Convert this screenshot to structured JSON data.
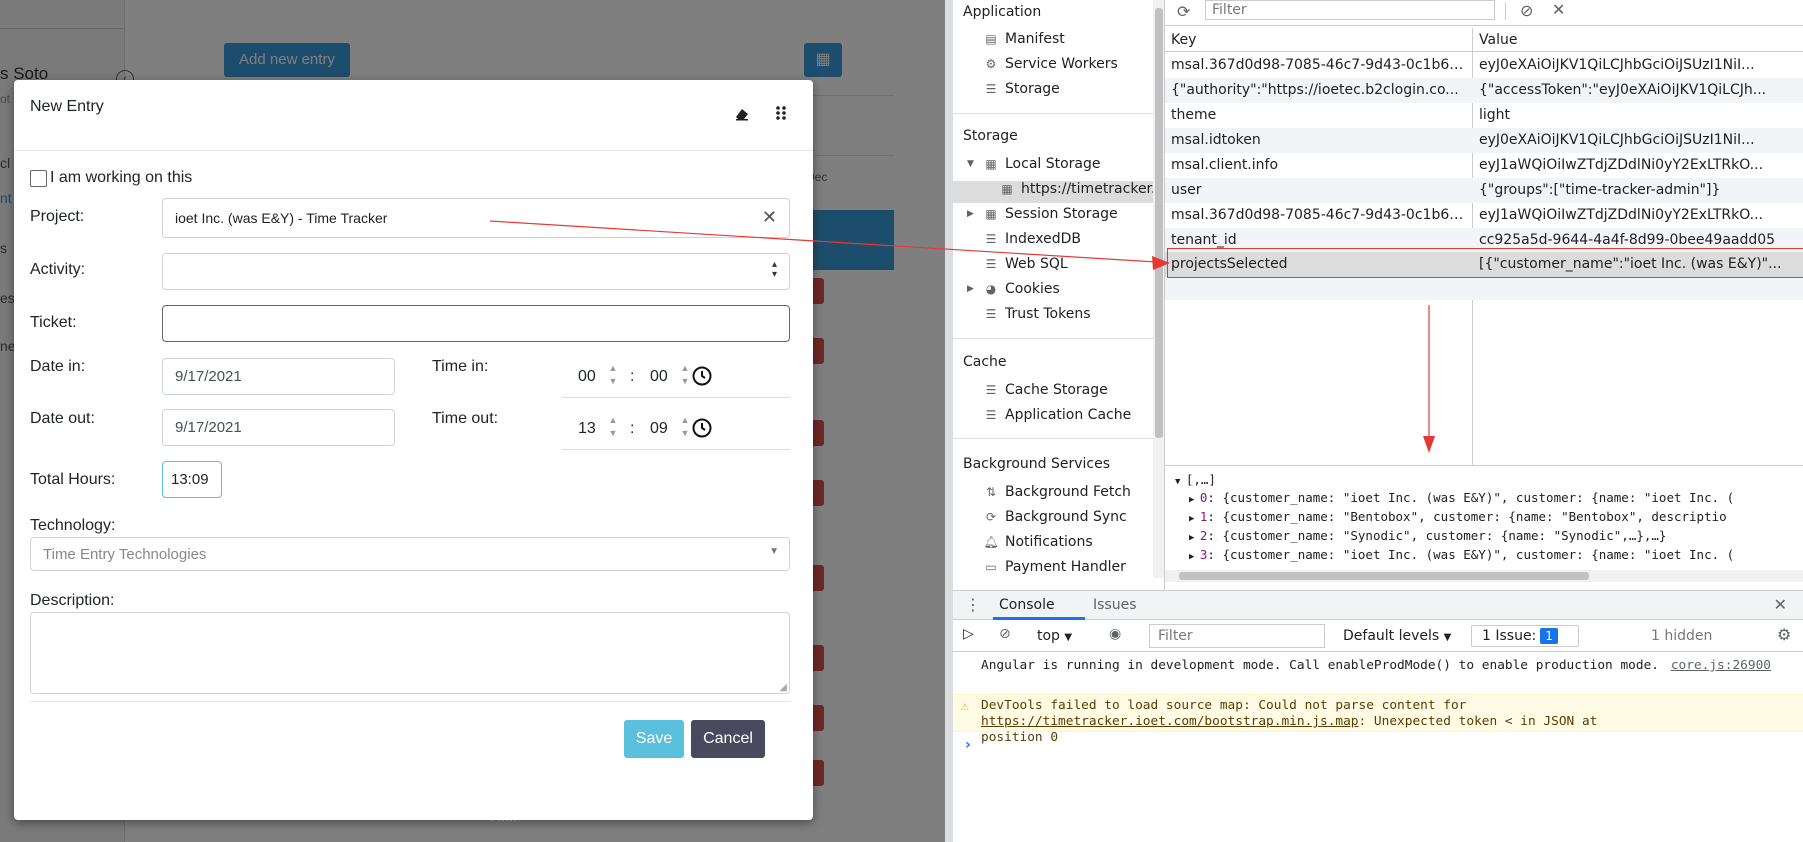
{
  "app": {
    "user_name": "s Soto",
    "user_sub": "ot",
    "nav_items": [
      "cl",
      "nt",
      "s",
      "es",
      "ne"
    ],
    "add_entry_label": "Add new entry",
    "dec_label": "Dec",
    "bottom_text": "P.M."
  },
  "modal": {
    "title": "New Entry",
    "working_label": "I am working on this",
    "project_label": "Project:",
    "project_value": "ioet Inc. (was E&Y) - Time Tracker",
    "activity_label": "Activity:",
    "ticket_label": "Ticket:",
    "date_in_label": "Date in:",
    "date_in_value": "9/17/2021",
    "time_in_label": "Time in:",
    "time_in_hour": "00",
    "time_in_min": "00",
    "date_out_label": "Date out:",
    "date_out_value": "9/17/2021",
    "time_out_label": "Time out:",
    "time_out_hour": "13",
    "time_out_min": "09",
    "colon": ":",
    "total_hours_label": "Total Hours:",
    "total_hours_value": "13:09",
    "technology_label": "Technology:",
    "technology_placeholder": "Time Entry Technologies",
    "description_label": "Description:",
    "save_label": "Save",
    "cancel_label": "Cancel"
  },
  "devtools": {
    "sidebar": {
      "application_header": "Application",
      "application_items": [
        "Manifest",
        "Service Workers",
        "Storage"
      ],
      "storage_header": "Storage",
      "local_storage": "Local Storage",
      "local_storage_origin": "https://timetracker.i",
      "storage_items": [
        "Session Storage",
        "IndexedDB",
        "Web SQL",
        "Cookies",
        "Trust Tokens"
      ],
      "cache_header": "Cache",
      "cache_items": [
        "Cache Storage",
        "Application Cache"
      ],
      "bg_header": "Background Services",
      "bg_items": [
        "Background Fetch",
        "Background Sync",
        "Notifications",
        "Payment Handler"
      ]
    },
    "filter_placeholder": "Filter",
    "table": {
      "key_header": "Key",
      "value_header": "Value",
      "rows": [
        {
          "key": "msal.367d0d98-7085-46c7-9d43-0c1b65...",
          "value": "eyJ0eXAiOiJKV1QiLCJhbGciOiJSUzI1NiI..."
        },
        {
          "key": "{\"authority\":\"https://ioetec.b2clogin.co...",
          "value": "{\"accessToken\":\"eyJ0eXAiOiJKV1QiLCJh..."
        },
        {
          "key": "theme",
          "value": "light"
        },
        {
          "key": "msal.idtoken",
          "value": "eyJ0eXAiOiJKV1QiLCJhbGciOiJSUzI1NiI..."
        },
        {
          "key": "msal.client.info",
          "value": "eyJ1aWQiOiIwZTdjZDdlNi0yY2ExLTRkO..."
        },
        {
          "key": "user",
          "value": "{\"groups\":[\"time-tracker-admin\"]}"
        },
        {
          "key": "msal.367d0d98-7085-46c7-9d43-0c1b65...",
          "value": "eyJ1aWQiOiIwZTdjZDdlNi0yY2ExLTRkO..."
        },
        {
          "key": "tenant_id",
          "value": "cc925a5d-9644-4a4f-8d99-0bee49aadd05"
        },
        {
          "key": "projectsSelected",
          "value": "[{\"customer_name\":\"ioet Inc. (was E&Y)\"..."
        }
      ]
    },
    "preview": {
      "root": "[,…]",
      "items": [
        {
          "idx": "0",
          "text": "{customer_name: \"ioet Inc. (was E&Y)\", customer: {name: \"ioet Inc. ("
        },
        {
          "idx": "1",
          "text": "{customer_name: \"Bentobox\", customer: {name: \"Bentobox\", descriptio"
        },
        {
          "idx": "2",
          "text": "{customer_name: \"Synodic\", customer: {name: \"Synodic\",…},…}"
        },
        {
          "idx": "3",
          "text": "{customer_name: \"ioet Inc. (was E&Y)\", customer: {name: \"ioet Inc. ("
        }
      ]
    },
    "console": {
      "tab_console": "Console",
      "tab_issues": "Issues",
      "context": "top",
      "filter_placeholder": "Filter",
      "levels": "Default levels",
      "issues_label": "1 Issue:",
      "issues_count": "1",
      "hidden": "1 hidden",
      "msg1": "Angular is running in development mode. Call enableProdMode() to enable production mode.",
      "msg1_src": "core.js:26900",
      "msg2_prefix": "DevTools failed to load source map: Could not parse content for ",
      "msg2_link": "https://timetracker.ioet.com/bootstrap.min.js.map",
      "msg2_suffix": ": Unexpected token < in JSON at position 0",
      "prompt": "›"
    }
  },
  "colors": {
    "accent": "#3a9ad9",
    "save": "#5bc0de",
    "cancel": "#4a4a5e",
    "annotation": "#e53935"
  }
}
